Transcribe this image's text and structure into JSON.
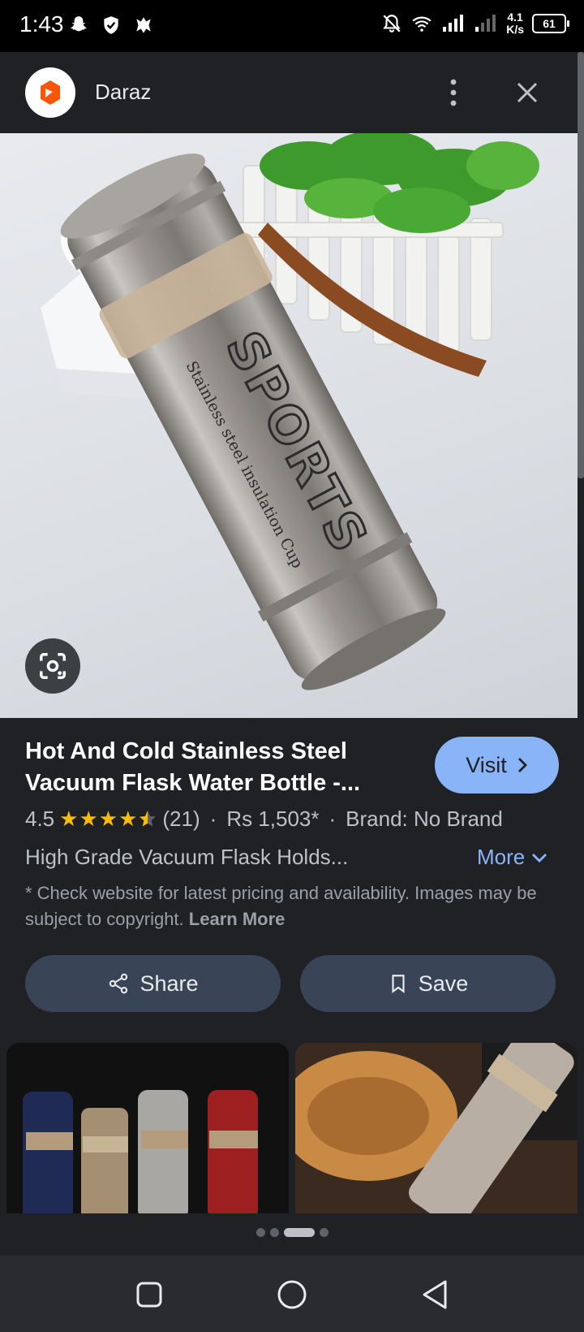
{
  "status_bar": {
    "time": "1:43",
    "network_speed_value": "4.1",
    "network_speed_unit": "K/s",
    "battery": "61"
  },
  "header": {
    "site_name": "Daraz",
    "brand_color": "#f85606"
  },
  "product": {
    "title": "Hot And Cold Stainless Steel Vacuum Flask Water Bottle -...",
    "visit_label": "Visit",
    "rating": "4.5",
    "stars": "★★★★",
    "review_count": "(21)",
    "price": "Rs 1,503*",
    "brand": "Brand: No Brand",
    "description": "High Grade Vacuum Flask Holds...",
    "more_label": "More",
    "disclaimer": "* Check website for latest pricing and availability. Images may be subject to copyright.",
    "learn_more_label": "Learn More",
    "image_print_main": "SPORTS",
    "image_print_sub": "Stainless steel insulation Cup"
  },
  "actions": {
    "share_label": "Share",
    "save_label": "Save"
  },
  "colors": {
    "accent": "#8ab4f8",
    "star": "#fbbc04",
    "background": "#202124",
    "action_button": "#394457"
  }
}
